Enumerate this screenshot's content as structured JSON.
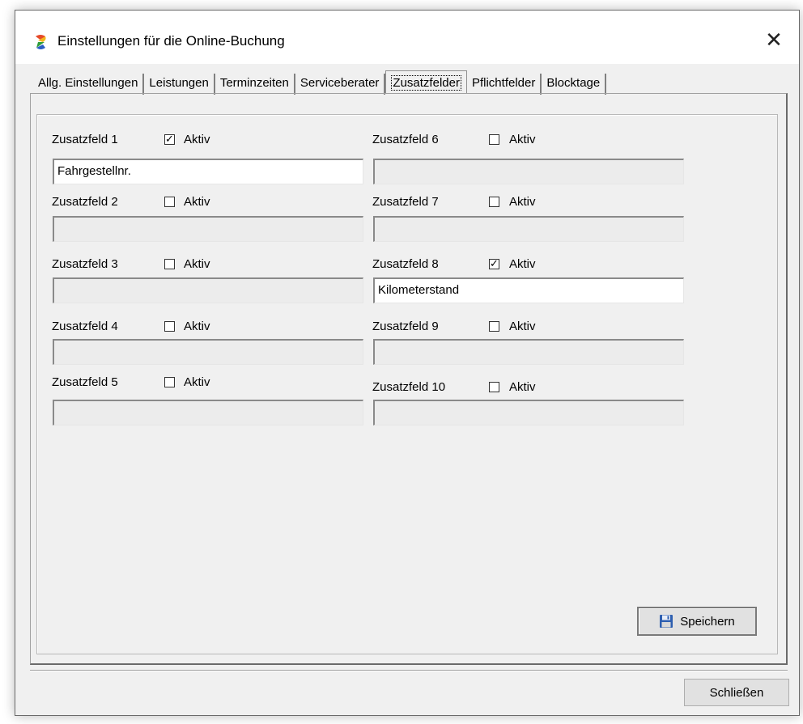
{
  "window": {
    "title": "Einstellungen für die Online-Buchung",
    "close_icon": "close-icon",
    "app_icon": "app-logo-icon"
  },
  "tabs": [
    {
      "label": "Allg. Einstellungen",
      "active": false
    },
    {
      "label": "Leistungen",
      "active": false
    },
    {
      "label": "Terminzeiten",
      "active": false
    },
    {
      "label": "Serviceberater",
      "active": false
    },
    {
      "label": "Zusatzfelder",
      "active": true
    },
    {
      "label": "Pflichtfelder",
      "active": false
    },
    {
      "label": "Blocktage",
      "active": false
    }
  ],
  "checkbox_label": "Aktiv",
  "fields": [
    {
      "label": "Zusatzfeld 1",
      "active": true,
      "value": "Fahrgestellnr."
    },
    {
      "label": "Zusatzfeld 2",
      "active": false,
      "value": ""
    },
    {
      "label": "Zusatzfeld 3",
      "active": false,
      "value": ""
    },
    {
      "label": "Zusatzfeld 4",
      "active": false,
      "value": ""
    },
    {
      "label": "Zusatzfeld 5",
      "active": false,
      "value": ""
    },
    {
      "label": "Zusatzfeld 6",
      "active": false,
      "value": ""
    },
    {
      "label": "Zusatzfeld 7",
      "active": false,
      "value": ""
    },
    {
      "label": "Zusatzfeld 8",
      "active": true,
      "value": "Kilometerstand"
    },
    {
      "label": "Zusatzfeld 9",
      "active": false,
      "value": ""
    },
    {
      "label": "Zusatzfeld 10",
      "active": false,
      "value": ""
    }
  ],
  "buttons": {
    "save_label": "Speichern",
    "save_icon": "floppy-disk-icon",
    "close_label": "Schließen"
  },
  "colors": {
    "window_bg": "#f0f0f0",
    "disabled_field_bg": "#ececec",
    "enabled_field_bg": "#ffffff"
  }
}
